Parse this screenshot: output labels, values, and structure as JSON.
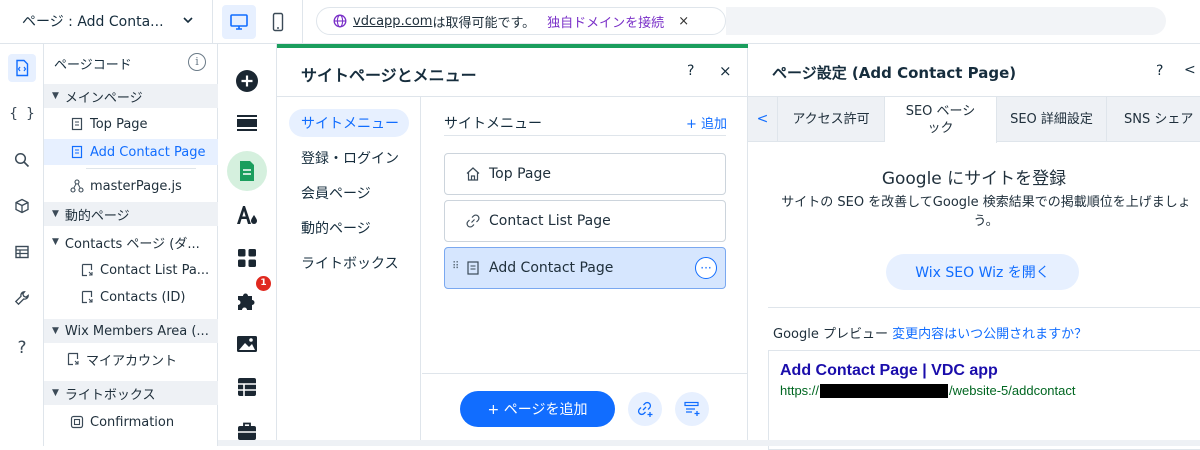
{
  "topbar": {
    "page_select_label": "ページ : Add Conta...",
    "domain_text": "vdcapp.com",
    "domain_suffix": "は取得可能です。",
    "connect_label": "独自ドメインを接続",
    "close_label": "×"
  },
  "rail": {
    "icons": [
      "page-code-icon",
      "braces-icon",
      "search-icon",
      "cube-icon",
      "table-icon",
      "wrench-icon",
      "help-icon"
    ],
    "help_label": "?"
  },
  "code_panel": {
    "title": "ページコード",
    "info_label": "i",
    "sections": {
      "main_pages": "メインページ",
      "dynamic_pages": "動的ページ",
      "members_area": "Wix Members Area (...",
      "lightboxes": "ライトボックス"
    },
    "items": {
      "top_page": "Top Page",
      "add_contact_page": "Add Contact Page",
      "master_page": "masterPage.js",
      "contacts_group": "Contacts ページ (ダ...",
      "contact_list_page": "Contact List Pa...",
      "contacts_id": "Contacts (ID)",
      "my_account": "マイアカウント",
      "confirmation": "Confirmation"
    }
  },
  "add_rail": {
    "notification_count": "1"
  },
  "pages_panel": {
    "title": "サイトページとメニュー",
    "help_label": "?",
    "close_label": "×",
    "categories": [
      "サイトメニュー",
      "登録・ログイン",
      "会員ページ",
      "動的ページ",
      "ライトボックス"
    ],
    "menu_heading": "サイトメニュー",
    "add_label": "+ 追加",
    "menu_items": [
      "Top Page",
      "Contact List Page",
      "Add Contact Page"
    ],
    "more_label": "···",
    "add_page_button": "+ ページを追加"
  },
  "settings": {
    "title": "ページ設定 (Add Contact Page)",
    "help_label": "?",
    "back_label": "<",
    "tabs": [
      "アクセス許可",
      "SEO ベーシック",
      "SEO 詳細設定",
      "SNS シェア"
    ],
    "tab_back_label": "<",
    "google_title": "Google にサイトを登録",
    "google_desc": "サイトの SEO を改善してGoogle 検索結果での掲載順位を上げましょう。",
    "seo_wiz_button": "Wix SEO Wiz を開く",
    "preview_label": "Google プレビュー",
    "preview_link": "変更内容はいつ公開されますか？",
    "preview_title": "Add Contact Page | VDC app",
    "preview_url_prefix": "https://",
    "preview_url_suffix": "/website-5/addcontact"
  },
  "colors": {
    "accent": "#116dff",
    "selection_bg": "#e7f0ff",
    "green_bar": "#1a9e5d",
    "badge": "#e0291f",
    "connect_link": "#7a30c8"
  }
}
